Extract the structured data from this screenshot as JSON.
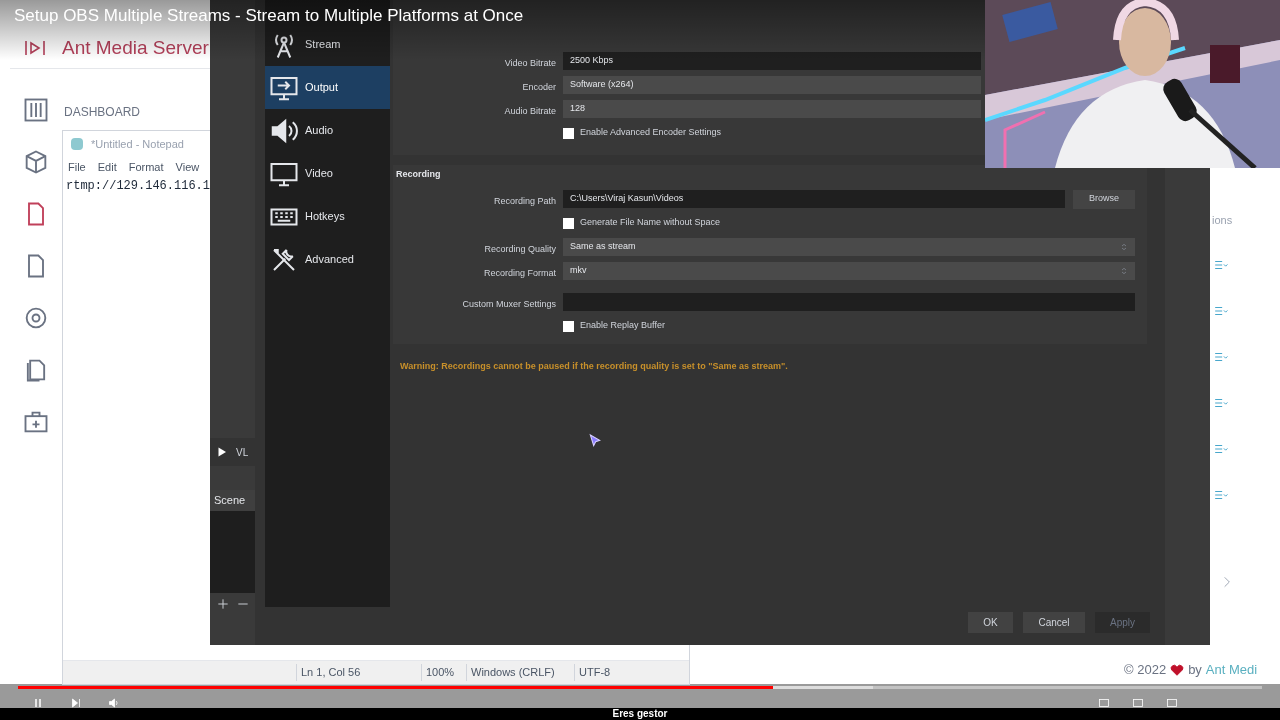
{
  "video_title": "Setup OBS Multiple Streams - Stream to Multiple Platforms at Once",
  "ams": {
    "brand": "Ant Media Server",
    "nav_heading": "DASHBOARD",
    "section_label": "ions",
    "footer": {
      "year": "© 2022",
      "by": "by",
      "link": "Ant Medi"
    }
  },
  "notepad": {
    "title": "*Untitled - Notepad",
    "menu": [
      "File",
      "Edit",
      "Format",
      "View"
    ],
    "text": "rtmp://129.146.116.1",
    "status": [
      "Ln 1, Col 56",
      "100%",
      "Windows (CRLF)",
      "UTF-8"
    ]
  },
  "obs": {
    "source": "VL",
    "scenes_header": "Scene"
  },
  "settings": {
    "nav": [
      {
        "label": "Stream",
        "selected": false
      },
      {
        "label": "Output",
        "selected": true
      },
      {
        "label": "Audio",
        "selected": false
      },
      {
        "label": "Video",
        "selected": false
      },
      {
        "label": "Hotkeys",
        "selected": false
      },
      {
        "label": "Advanced",
        "selected": false
      }
    ],
    "streaming": [
      {
        "kind": "input",
        "label": "Video Bitrate",
        "value": "2500 Kbps"
      },
      {
        "kind": "select",
        "label": "Encoder",
        "value": "Software (x264)"
      },
      {
        "kind": "select",
        "label": "Audio Bitrate",
        "value": "128"
      },
      {
        "kind": "checkbox",
        "label": "Enable Advanced Encoder Settings",
        "checked": false
      }
    ],
    "recording": {
      "title": "Recording",
      "fields": [
        {
          "kind": "path",
          "label": "Recording Path",
          "value": "C:\\Users\\Viraj Kasun\\Videos",
          "button": "Browse"
        },
        {
          "kind": "checkbox",
          "label": "Generate File Name without Space",
          "checked": false
        },
        {
          "kind": "combo",
          "label": "Recording Quality",
          "value": "Same as stream"
        },
        {
          "kind": "combo",
          "label": "Recording Format",
          "value": "mkv"
        },
        {
          "kind": "input",
          "label": "Custom Muxer Settings"
        },
        {
          "kind": "checkbox",
          "label": "Enable Replay Buffer",
          "checked": false
        }
      ]
    },
    "warning": "Warning: Recordings cannot be paused if the recording quality is set to \"Same as stream\".",
    "buttons": [
      {
        "label": "OK",
        "disabled": false
      },
      {
        "label": "Cancel",
        "disabled": false
      },
      {
        "label": "Apply",
        "disabled": true
      }
    ]
  },
  "player": {
    "progress": {
      "level": 0.607
    },
    "buffer": {
      "level": 0.687
    }
  },
  "caption": "Eres gestor"
}
